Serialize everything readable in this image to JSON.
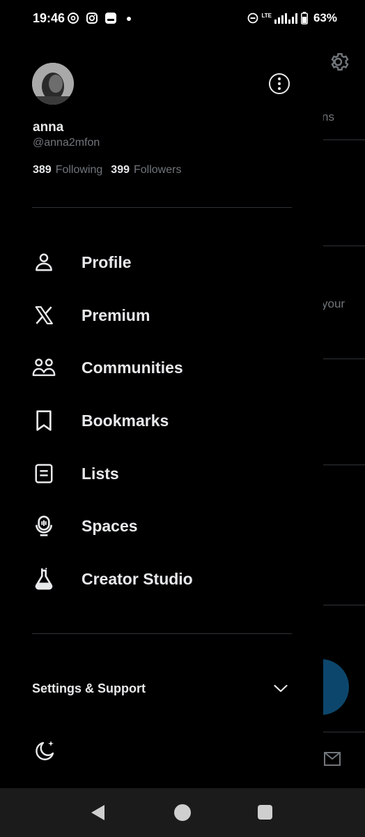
{
  "status_bar": {
    "time": "19:46",
    "network": "LTE",
    "battery": "63%"
  },
  "background": {
    "partial_text_1": "ns",
    "partial_text_2": "your"
  },
  "profile": {
    "name": "anna",
    "handle": "@anna2mfon",
    "following_count": "389",
    "following_label": "Following",
    "followers_count": "399",
    "followers_label": "Followers"
  },
  "menu": [
    {
      "label": "Profile",
      "icon": "person-icon"
    },
    {
      "label": "Premium",
      "icon": "x-logo-icon"
    },
    {
      "label": "Communities",
      "icon": "communities-icon"
    },
    {
      "label": "Bookmarks",
      "icon": "bookmark-icon"
    },
    {
      "label": "Lists",
      "icon": "list-icon"
    },
    {
      "label": "Spaces",
      "icon": "spaces-icon"
    },
    {
      "label": "Creator Studio",
      "icon": "flask-icon"
    }
  ],
  "settings_support": {
    "label": "Settings & Support"
  },
  "colors": {
    "background": "#000000",
    "text_primary": "#e7e9ea",
    "text_secondary": "#71767b",
    "divider": "#2f3336",
    "accent": "#1d9bf0"
  }
}
